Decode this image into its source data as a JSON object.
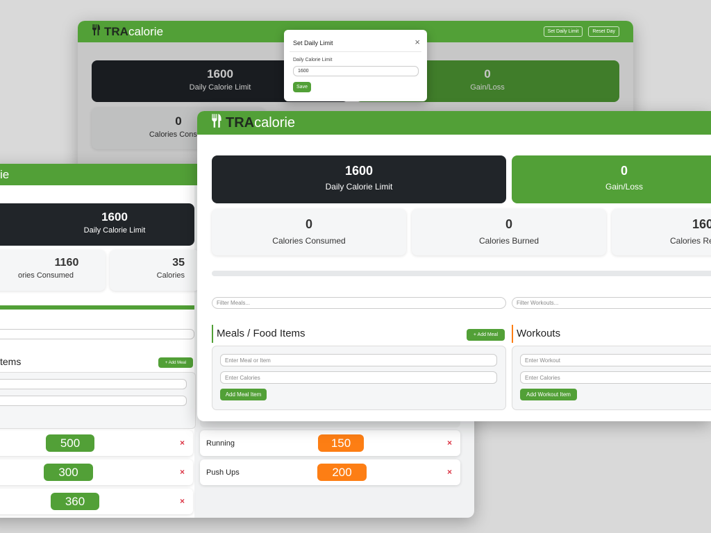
{
  "logo": {
    "bold": "TRA",
    "rest": "calorie"
  },
  "back_window": {
    "header_buttons": [
      "Set Daily Limit",
      "Reset Day"
    ],
    "limit": {
      "value": "1600",
      "label": "Daily Calorie Limit"
    },
    "gain": {
      "value": "0",
      "label": "Gain/Loss"
    },
    "consumed": {
      "value": "0",
      "label": "Calories Consum"
    }
  },
  "modal": {
    "title": "Set Daily Limit",
    "field_label": "Daily Calorie Limit",
    "field_value": "1600",
    "save_label": "Save"
  },
  "left_window": {
    "logo_partial": "ie",
    "limit": {
      "value": "1600",
      "label": "Daily Calorie Limit"
    },
    "consumed": {
      "value": "1160",
      "label": "ories Consumed"
    },
    "burned": {
      "value": "35",
      "label": "Calories"
    },
    "section_title": "tems",
    "add_meal_label": "+ Add Meal",
    "meals": [
      {
        "calories": "500"
      },
      {
        "calories": "300"
      },
      {
        "calories": "360"
      }
    ],
    "workouts": [
      {
        "name": "Running",
        "calories": "150"
      },
      {
        "name": "Push Ups",
        "calories": "200"
      }
    ]
  },
  "front_window": {
    "limit": {
      "value": "1600",
      "label": "Daily Calorie Limit"
    },
    "gain": {
      "value": "0",
      "label": "Gain/Loss"
    },
    "consumed": {
      "value": "0",
      "label": "Calories Consumed"
    },
    "burned": {
      "value": "0",
      "label": "Calories Burned"
    },
    "remaining": {
      "value": "160",
      "label": "Calories Re"
    },
    "filter_meals_placeholder": "Filter Meals...",
    "filter_workouts_placeholder": "Filter Workouts...",
    "meals_title": "Meals / Food Items",
    "add_meal_label": "+ Add Meal",
    "meal_placeholder": "Enter Meal or Item",
    "meal_calories_placeholder": "Enter Calories",
    "add_meal_item_label": "Add Meal Item",
    "workouts_title": "Workouts",
    "workout_placeholder": "Enter Workout",
    "workout_calories_placeholder": "Enter Calories",
    "add_workout_item_label": "Add Workout Item"
  },
  "colors": {
    "brand": "#52a037",
    "dark": "#212529",
    "workout": "#fd7e14",
    "delete": "#dc3545"
  },
  "icons": [
    "fork-knife-icon",
    "close-icon",
    "delete-icon"
  ]
}
